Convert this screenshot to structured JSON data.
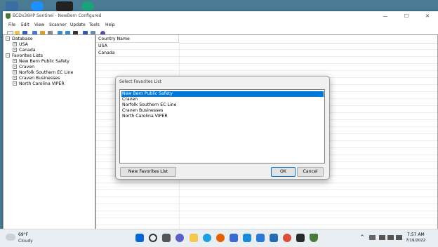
{
  "window": {
    "title": "BCDx36HP Sentinel - NewBern Configured",
    "minimize": "—",
    "maximize": "☐",
    "close": "✕"
  },
  "menu": [
    "File",
    "Edit",
    "View",
    "Scanner",
    "Update",
    "Tools",
    "Help"
  ],
  "tree": {
    "database": "Database",
    "usa": "USA",
    "canada": "Canada",
    "favorites": "Favorites Lists",
    "lists": [
      "New Bern Public Safety",
      "Craven",
      "Norfolk Southern EC Line",
      "Craven Businesses",
      "North Carolina VIPER"
    ],
    "expander_minus": "−",
    "expander_plus": "+"
  },
  "list_view": {
    "column": "Country Name",
    "rows": [
      "USA",
      "Canada"
    ]
  },
  "dialog": {
    "title": "Select Favorites List",
    "items": [
      "New Bern Public Safety",
      "Craven",
      "Norfolk Southern EC Line",
      "Craven Businesses",
      "North Carolina VIPER"
    ],
    "selected_index": 0,
    "new_button": "New Favorites List",
    "ok_button": "OK",
    "cancel_button": "Cancel"
  },
  "taskbar": {
    "temperature": "69°F",
    "condition": "Cloudy",
    "time": "7:57 AM",
    "date": "7/19/2022",
    "tray": "^"
  },
  "colors": {
    "accent": "#0078d7",
    "desktop": "#4a7a94"
  }
}
